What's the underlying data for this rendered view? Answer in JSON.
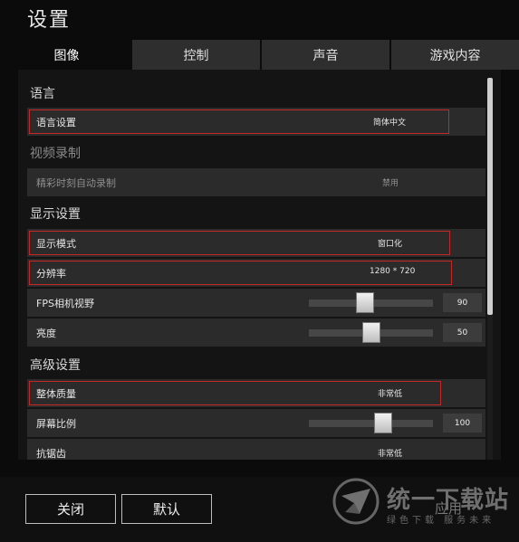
{
  "window": {
    "title": "设置"
  },
  "tabs": [
    {
      "label": "图像",
      "active": true
    },
    {
      "label": "控制",
      "active": false
    },
    {
      "label": "声音",
      "active": false
    },
    {
      "label": "游戏内容",
      "active": false
    }
  ],
  "sections": {
    "language": "语言",
    "video": "视频录制",
    "display": "显示设置",
    "advanced": "高级设置"
  },
  "settings": {
    "language": {
      "label": "语言设置",
      "value": "简体中文"
    },
    "highlight": {
      "label": "精彩时刻自动录制",
      "value": "禁用"
    },
    "display_mode": {
      "label": "显示模式",
      "value": "窗口化"
    },
    "resolution": {
      "label": "分辨率",
      "value": "1280 * 720"
    },
    "fov": {
      "label": "FPS相机视野",
      "value": "90",
      "level": 0.45
    },
    "brightness": {
      "label": "亮度",
      "value": "50",
      "level": 0.5
    },
    "quality": {
      "label": "整体质量",
      "value": "非常低"
    },
    "screen_scale": {
      "label": "屏幕比例",
      "value": "100",
      "level": 0.6
    },
    "antialias": {
      "label": "抗锯齿",
      "value": "非常低"
    }
  },
  "footer": {
    "close": "关闭",
    "default": "默认",
    "apply": "应用"
  },
  "watermark": {
    "title": "统一下载站",
    "subtitle": "绿色下载 服务未来"
  },
  "colors": {
    "highlight_border": "#c62828",
    "row_bg": "#2b2b2b",
    "tab_inactive": "#2e2e2e"
  }
}
